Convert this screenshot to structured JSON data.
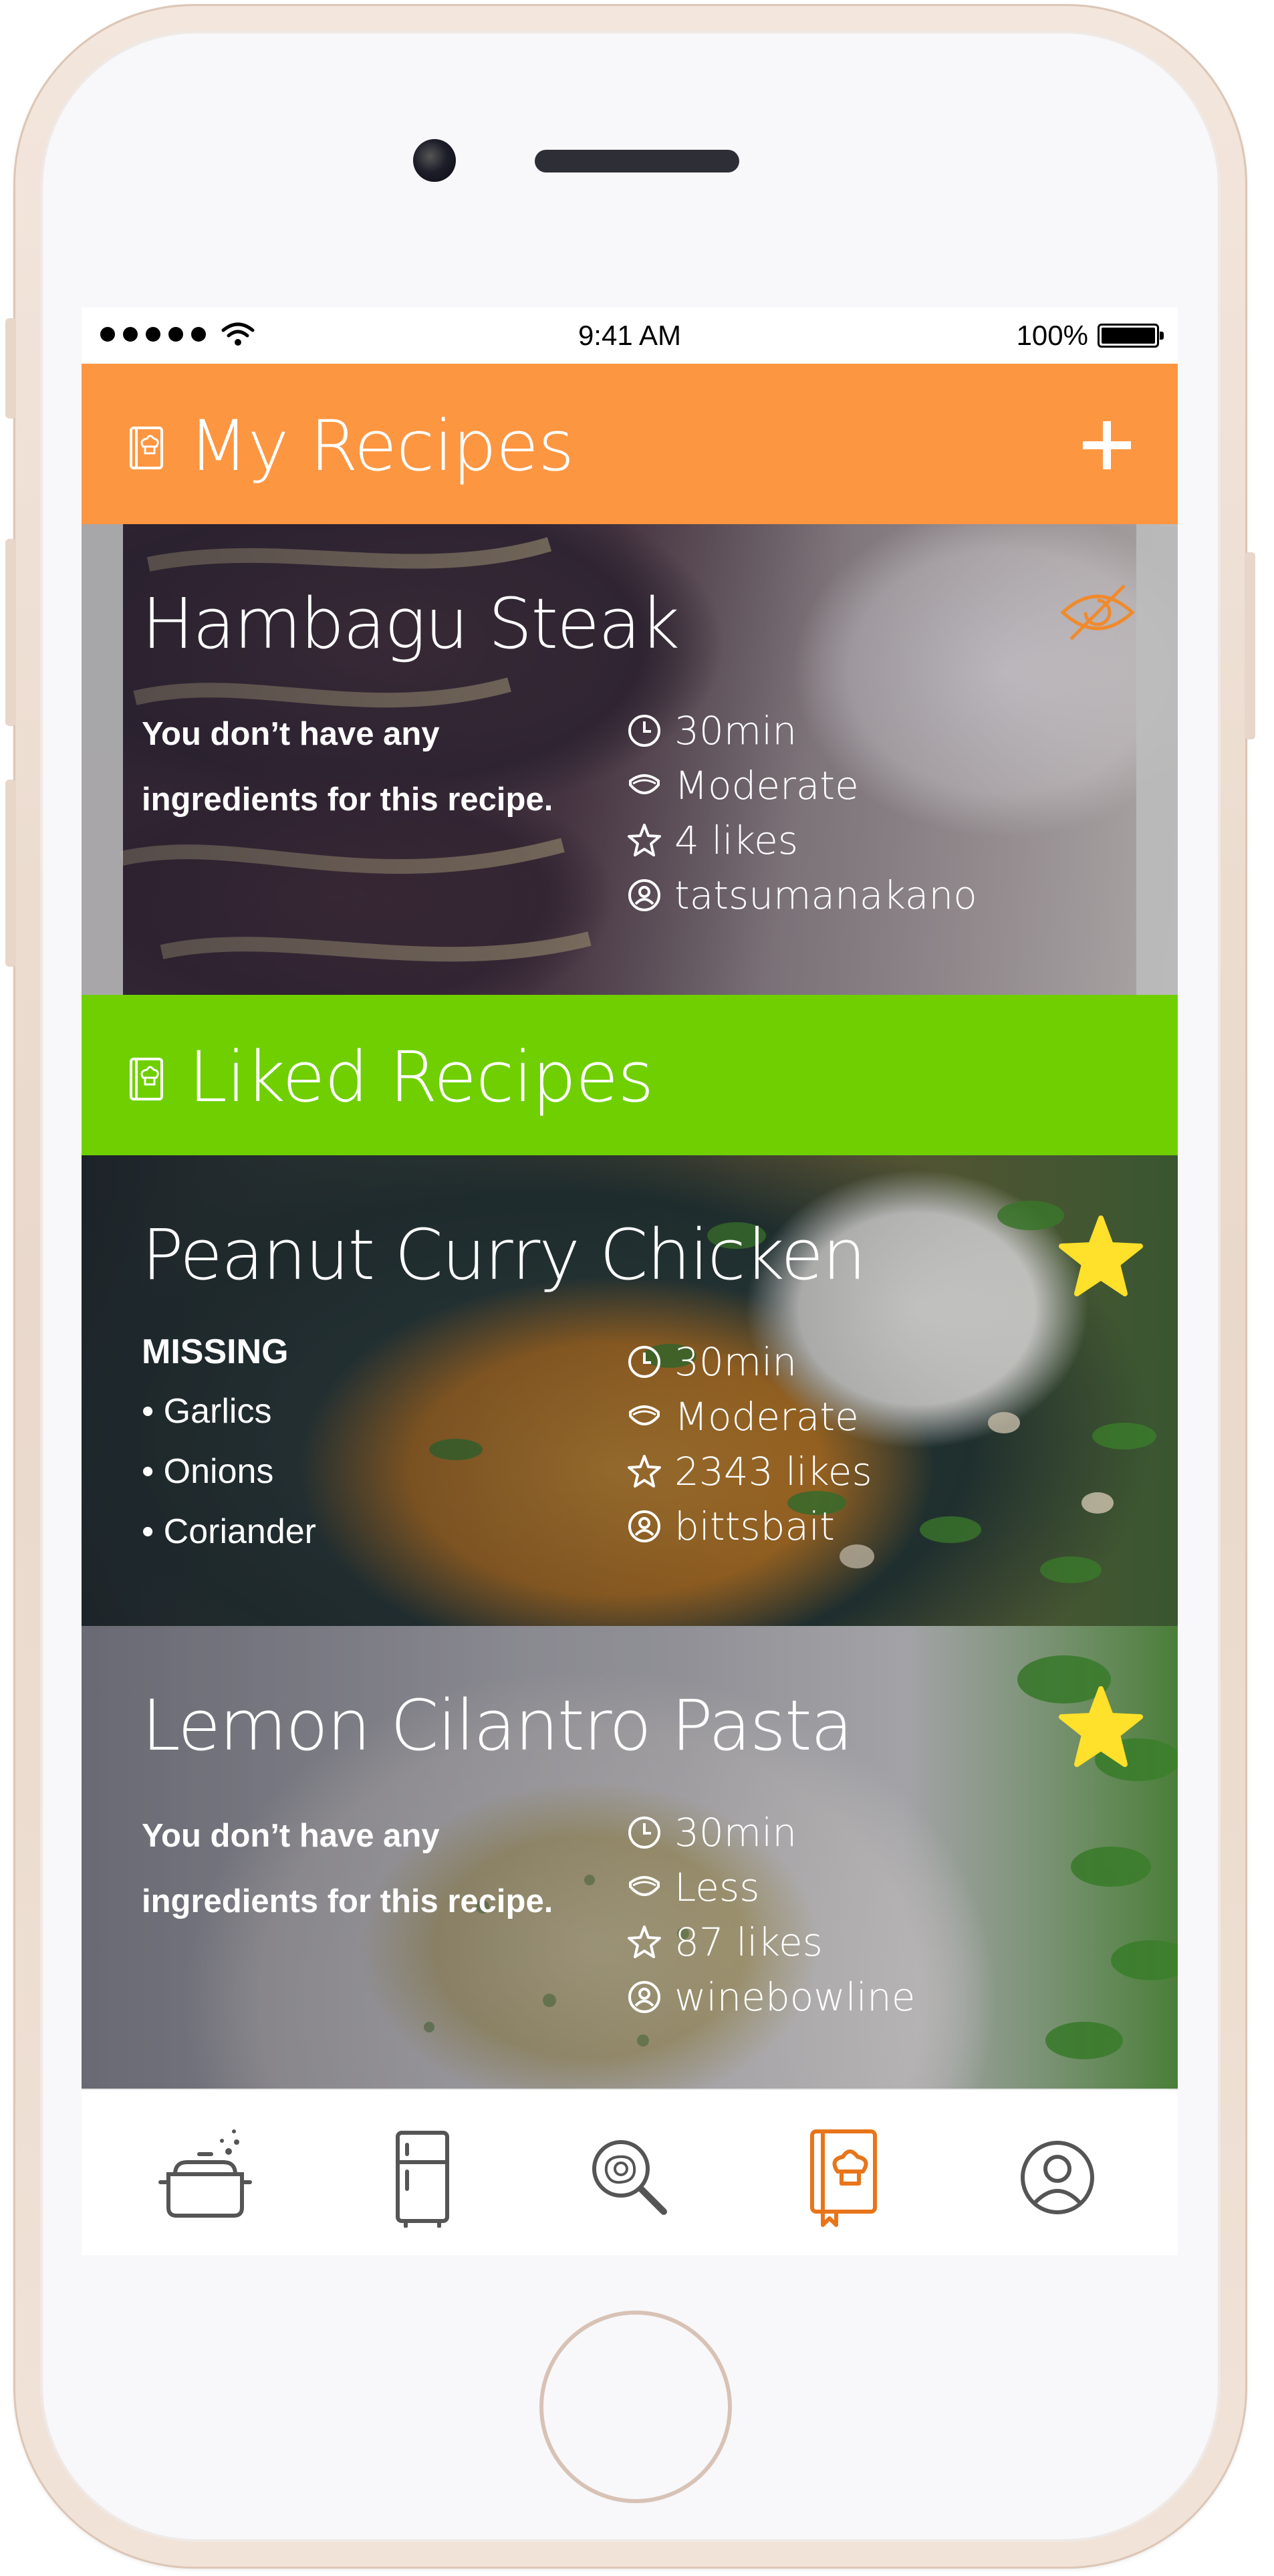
{
  "status_bar": {
    "time": "9:41 AM",
    "battery": "100%"
  },
  "sections": {
    "my_recipes": {
      "title": "My Recipes",
      "color": "#fd9641"
    },
    "liked_recipes": {
      "title": "Liked Recipes",
      "color": "#6fcf00"
    }
  },
  "recipes": [
    {
      "name": "Hambagu Steak",
      "ingredients_note_line1": "You don’t have any",
      "ingredients_note_line2": "ingredients for this recipe.",
      "time": "30min",
      "difficulty": "Moderate",
      "likes": "4 likes",
      "author": "tatsumanakano",
      "action_icon": "eye-slash-icon"
    },
    {
      "name": "Peanut Curry Chicken",
      "missing_label": "MISSING",
      "missing": [
        "• Garlics",
        "• Onions",
        "• Coriander"
      ],
      "time": "30min",
      "difficulty": "Moderate",
      "likes": "2343 likes",
      "author": "bittsbait",
      "action_icon": "star-icon"
    },
    {
      "name": "Lemon Cilantro Pasta",
      "ingredients_note_line1": "You don’t have any",
      "ingredients_note_line2": "ingredients for this recipe.",
      "time": "30min",
      "difficulty": "Less",
      "likes": "87 likes",
      "author": "winebowline",
      "action_icon": "star-icon"
    }
  ],
  "tab_bar": {
    "items": [
      "cooking-pot-icon",
      "fridge-icon",
      "search-egg-icon",
      "recipe-book-icon",
      "profile-icon"
    ],
    "active": "recipe-book-icon",
    "active_color": "#e8751a",
    "inactive_color": "#555555"
  },
  "colors": {
    "favorite_star": "#ffe02a",
    "hidden_icon": "#f08a2c"
  }
}
